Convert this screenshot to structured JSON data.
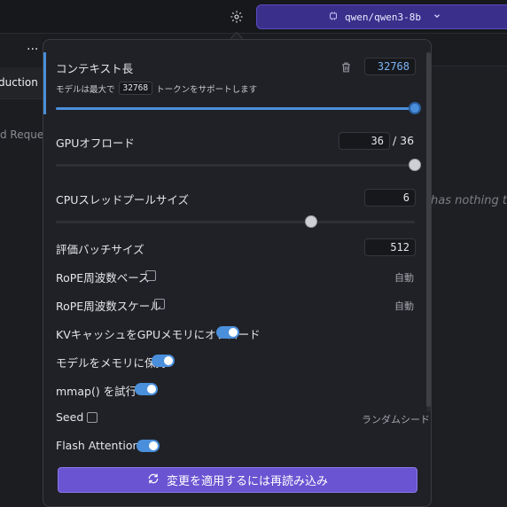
{
  "header": {
    "model_chip_icon": "cpu-chip-icon",
    "model_name": "qwen/qwen3-8b",
    "gear_icon": "gear-icon",
    "chevron_icon": "chevron-down-icon"
  },
  "background": {
    "menu_dots": "...",
    "tab_label": "duction",
    "request_text": "d Reque",
    "empty_text": "has nothing t"
  },
  "settings": {
    "context_length": {
      "label": "コンテキスト長",
      "value": "32768",
      "hint_prefix": "モデルは最大で",
      "hint_value": "32768",
      "hint_suffix": "トークンをサポートします",
      "slider_fraction": 1.0
    },
    "gpu_offload": {
      "label": "GPUオフロード",
      "value": "36",
      "max": "/ 36",
      "slider_fraction": 1.0
    },
    "cpu_threads": {
      "label": "CPUスレッドプールサイズ",
      "value": "6",
      "slider_fraction": 0.71
    },
    "eval_batch": {
      "label": "評価バッチサイズ",
      "value": "512"
    },
    "rope_base": {
      "label": "RoPE周波数ベース",
      "checked": false,
      "right": "自動"
    },
    "rope_scale": {
      "label": "RoPE周波数スケール",
      "checked": false,
      "right": "自動"
    },
    "kv_offload": {
      "label": "KVキャッシュをGPUメモリにオフロード",
      "on": true
    },
    "keep_in_memory": {
      "label": "モデルをメモリに保持",
      "on": true
    },
    "mmap": {
      "label": "mmap() を試行",
      "on": true
    },
    "seed": {
      "label": "Seed",
      "checked": false,
      "right": "ランダムシード"
    },
    "flash_attention": {
      "label": "Flash Attention",
      "on": true
    }
  },
  "reload_button": {
    "icon": "refresh-icon",
    "label": "変更を適用するには再読み込み"
  },
  "colors": {
    "accent": "#4a8fdb",
    "button": "#6a54d2",
    "model_button": "#3b2f8c"
  }
}
